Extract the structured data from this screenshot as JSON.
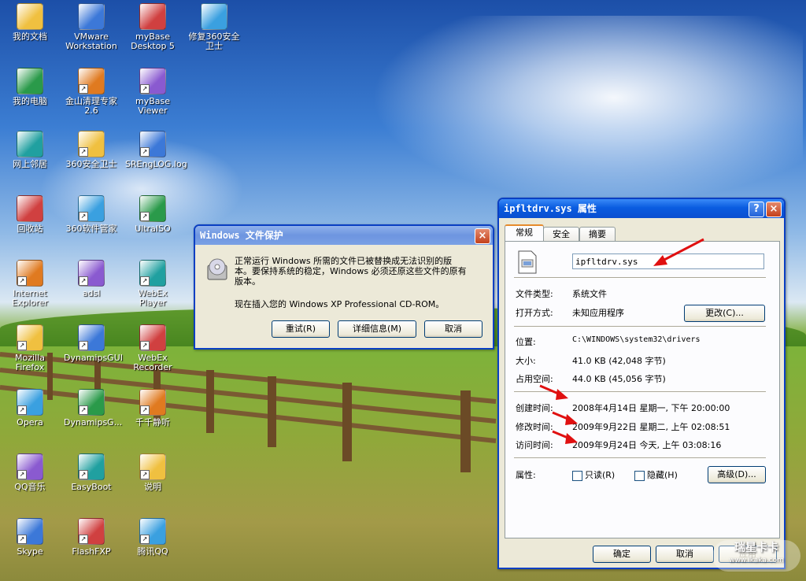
{
  "desktop": {
    "icons": [
      {
        "label": "我的文档",
        "icon": "my-documents-icon"
      },
      {
        "label": "VMware\nWorkstation",
        "icon": "vmware-icon"
      },
      {
        "label": "myBase\nDesktop 5",
        "icon": "mybase-desktop-icon"
      },
      {
        "label": "修复360安全\n卫士",
        "icon": "ie-repair-icon"
      },
      {
        "label": "我的电脑",
        "icon": "my-computer-icon"
      },
      {
        "label": "金山清理专家\n2.6",
        "icon": "kingsoft-cleaner-icon"
      },
      {
        "label": "myBase\nViewer",
        "icon": "mybase-viewer-icon"
      },
      {
        "label": "网上邻居",
        "icon": "network-places-icon"
      },
      {
        "label": "360安全卫士",
        "icon": "360-safe-icon"
      },
      {
        "label": "SREngLOG.log",
        "icon": "log-file-icon"
      },
      {
        "label": "回收站",
        "icon": "recycle-bin-icon"
      },
      {
        "label": "360软件管家",
        "icon": "360-software-icon"
      },
      {
        "label": "UltraISO",
        "icon": "ultraiso-icon"
      },
      {
        "label": "Internet\nExplorer",
        "icon": "internet-explorer-icon"
      },
      {
        "label": "adsl",
        "icon": "adsl-icon"
      },
      {
        "label": "WebEx Player",
        "icon": "webex-player-icon"
      },
      {
        "label": "Mozilla\nFirefox",
        "icon": "firefox-icon"
      },
      {
        "label": "DynamipsGUI",
        "icon": "dynamips-gui-icon"
      },
      {
        "label": "WebEx\nRecorder",
        "icon": "webex-recorder-icon"
      },
      {
        "label": "Opera",
        "icon": "opera-icon"
      },
      {
        "label": "DynamipsG...",
        "icon": "dynamips-icon"
      },
      {
        "label": "千千静听",
        "icon": "ttplayer-icon"
      },
      {
        "label": "QQ音乐",
        "icon": "qq-music-icon"
      },
      {
        "label": "EasyBoot",
        "icon": "easyboot-icon"
      },
      {
        "label": "说明",
        "icon": "text-file-icon"
      },
      {
        "label": "Skype",
        "icon": "skype-icon"
      },
      {
        "label": "FlashFXP",
        "icon": "flashfxp-icon"
      },
      {
        "label": "腾讯QQ",
        "icon": "tencent-qq-icon"
      }
    ]
  },
  "wfp_dialog": {
    "title": "Windows 文件保护",
    "close": "×",
    "message_line1": "正常运行 Windows 所需的文件已被替换成无法识别的版",
    "message_line2": "本。要保持系统的稳定，Windows 必须还原这些文件的原有",
    "message_line3": "版本。",
    "prompt": "现在插入您的 Windows XP Professional CD-ROM。",
    "retry": "重试(R)",
    "details": "详细信息(M)",
    "cancel": "取消"
  },
  "props_dialog": {
    "title": "ipfltdrv.sys 属性",
    "help": "?",
    "close": "×",
    "tabs": [
      "常规",
      "安全",
      "摘要"
    ],
    "filename": "ipfltdrv.sys",
    "type_label": "文件类型:",
    "type_value": "系统文件",
    "open_label": "打开方式:",
    "open_value": "未知应用程序",
    "change": "更改(C)...",
    "location_label": "位置:",
    "location_value": "C:\\WINDOWS\\system32\\drivers",
    "size_label": "大小:",
    "size_value": "41.0 KB (42,048 字节)",
    "disk_label": "占用空间:",
    "disk_value": "44.0 KB (45,056 字节)",
    "created_label": "创建时间:",
    "created_value": "2008年4月14日 星期一, 下午 20:00:00",
    "modified_label": "修改时间:",
    "modified_value": "2009年9月22日 星期二, 上午 02:08:51",
    "accessed_label": "访问时间:",
    "accessed_value": "2009年9月24日 今天, 上午 03:08:16",
    "attr_label": "属性:",
    "readonly": "只读(R)",
    "hidden": "隐藏(H)",
    "advanced": "高级(D)...",
    "ok": "确定",
    "cancel": "取消",
    "apply": "应用"
  },
  "watermark": {
    "title": "瑞星卡卡",
    "url": "www.ikaka.com"
  },
  "colors": {
    "title_active": "#0a5ce0",
    "title_inactive": "#7aa0e5",
    "dialog_bg": "#ece9d8",
    "arrow": "#e01010"
  }
}
